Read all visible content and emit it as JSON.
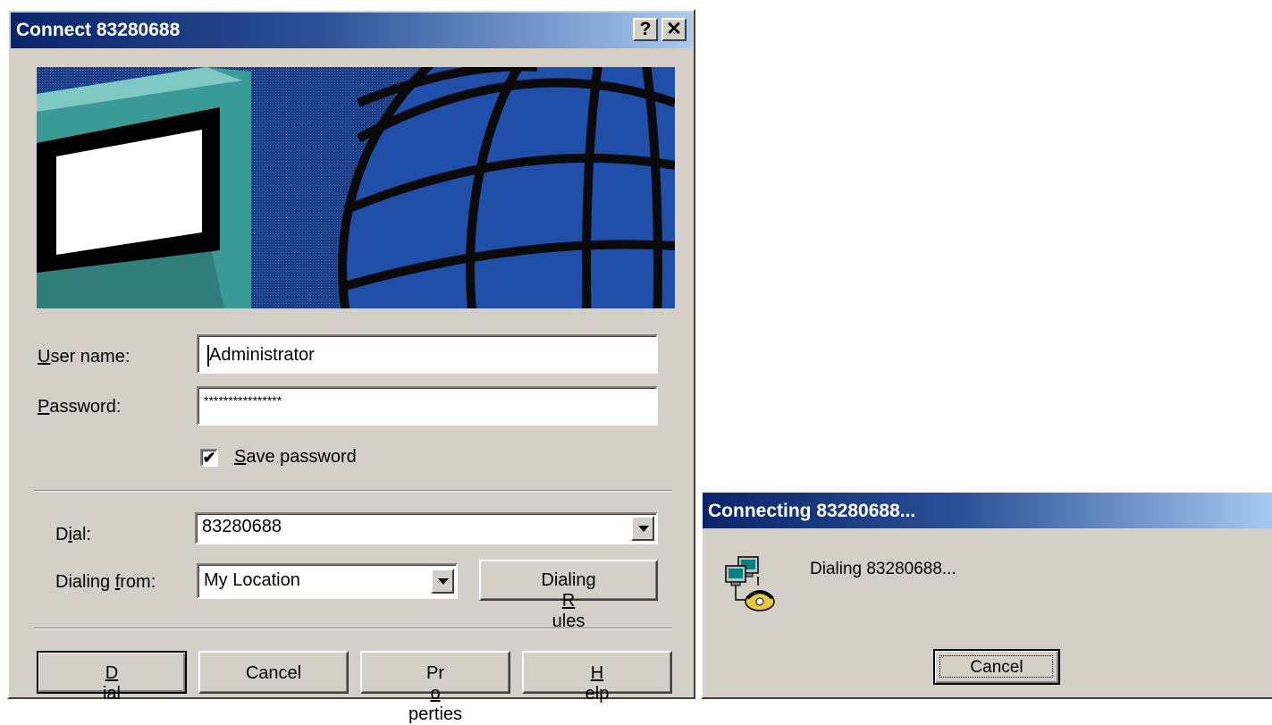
{
  "main_dialog": {
    "title": "Connect 83280688",
    "help_glyph": "?",
    "close_glyph": "✕",
    "user_name": {
      "label_key": "U",
      "label_rest": "ser name:",
      "value": "Administrator"
    },
    "password": {
      "label_key": "P",
      "label_rest": "assword:",
      "value": "****************"
    },
    "save_password": {
      "checked": true,
      "check_glyph": "✔",
      "label_key": "S",
      "label_rest": "ave password"
    },
    "dial": {
      "label_pre": "D",
      "label_key": "i",
      "label_rest": "al:",
      "value": "83280688"
    },
    "dialing_from": {
      "label_pre": "Dialing ",
      "label_key": "f",
      "label_rest": "rom:",
      "value": "My Location"
    },
    "dialing_rules_button": {
      "pre": "Dialing ",
      "key": "R",
      "rest": "ules"
    },
    "buttons": {
      "dial": {
        "key": "D",
        "rest": "ial"
      },
      "cancel": "Cancel",
      "properties": {
        "pre": "Pr",
        "key": "o",
        "rest": "perties"
      },
      "help": {
        "key": "H",
        "rest": "elp"
      }
    }
  },
  "connecting_dialog": {
    "title": "Connecting 83280688...",
    "status": "Dialing 83280688...",
    "cancel_label": "Cancel",
    "icon": "network-dialing-icon"
  },
  "colors": {
    "face": "#d4d0c8",
    "title_start": "#0a246a",
    "title_end": "#a6caf0",
    "banner_blue": "#1c3e86"
  }
}
